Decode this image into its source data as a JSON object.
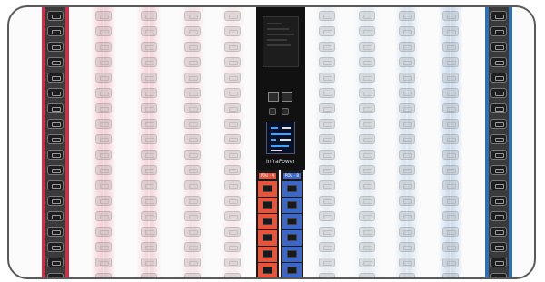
{
  "product": {
    "brand_label": "InfraPower",
    "bank_labels": [
      "PDU - A",
      "PDU - B"
    ]
  },
  "colors": {
    "red_strip": "#c8334a",
    "blue_strip": "#2f6fb3",
    "bank_a": "#e8533a",
    "bank_b": "#3a67c8",
    "controller": "#111111"
  },
  "icons": {
    "outlet": "power-outlet-icon",
    "network_port": "ethernet-port-icon",
    "display": "lcd-display-icon"
  }
}
